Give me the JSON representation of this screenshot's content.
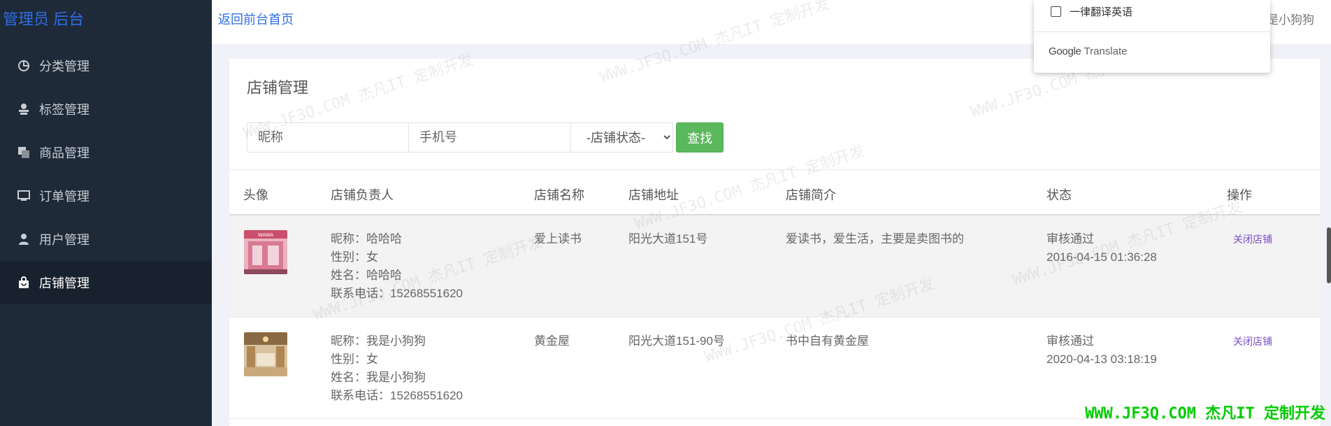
{
  "sidebar": {
    "brand": "管理员 后台",
    "items": [
      {
        "label": "分类管理",
        "icon": "pie-chart-icon"
      },
      {
        "label": "标签管理",
        "icon": "tag-user-icon"
      },
      {
        "label": "商品管理",
        "icon": "copy-icon"
      },
      {
        "label": "订单管理",
        "icon": "monitor-icon"
      },
      {
        "label": "用户管理",
        "icon": "user-icon"
      },
      {
        "label": "店铺管理",
        "icon": "shopping-bag-icon",
        "active": true
      }
    ]
  },
  "topbar": {
    "back_link": "返回前台首页",
    "user_name": "是小狗狗"
  },
  "translate_popup": {
    "option": "一律翻译英语",
    "brand_google": "Google",
    "brand_translate": "Translate"
  },
  "panel": {
    "title": "店铺管理",
    "search": {
      "nickname_placeholder": "昵称",
      "phone_placeholder": "手机号",
      "status_selected": "-店铺状态-",
      "find_label": "查找"
    },
    "columns": [
      "头像",
      "店铺负责人",
      "店铺名称",
      "店铺地址",
      "店铺简介",
      "状态",
      "操作"
    ],
    "rows": [
      {
        "owner": [
          "昵称：哈哈哈",
          "性别：女",
          "姓名：哈哈哈",
          "联系电话：15268551620"
        ],
        "shop_name": "爱上读书",
        "address": "阳光大道151号",
        "intro": "爱读书，爱生活，主要是卖图书的",
        "status": "审核通过",
        "time": "2016-04-15 01:36:28",
        "action": "关闭店铺",
        "thumb_sign": "WAWA"
      },
      {
        "owner": [
          "昵称：我是小狗狗",
          "性别：女",
          "姓名：我是小狗狗",
          "联系电话：15268551620"
        ],
        "shop_name": "黄金屋",
        "address": "阳光大道151-90号",
        "intro": "书中自有黄金屋",
        "status": "审核通过",
        "time": "2020-04-13 03:18:19",
        "action": "关闭店铺"
      }
    ]
  },
  "watermark": {
    "text": "WWW.JF3Q.COM 杰凡IT 定制开发",
    "footer": "WWW.JF3Q.COM 杰凡IT  定制开发"
  },
  "colors": {
    "sidebar_bg": "#1e2a38",
    "accent_blue": "#2f6ee5",
    "find_button": "#5cb85c",
    "action_link": "#7a4fc7",
    "footer_watermark": "#00cc00"
  }
}
